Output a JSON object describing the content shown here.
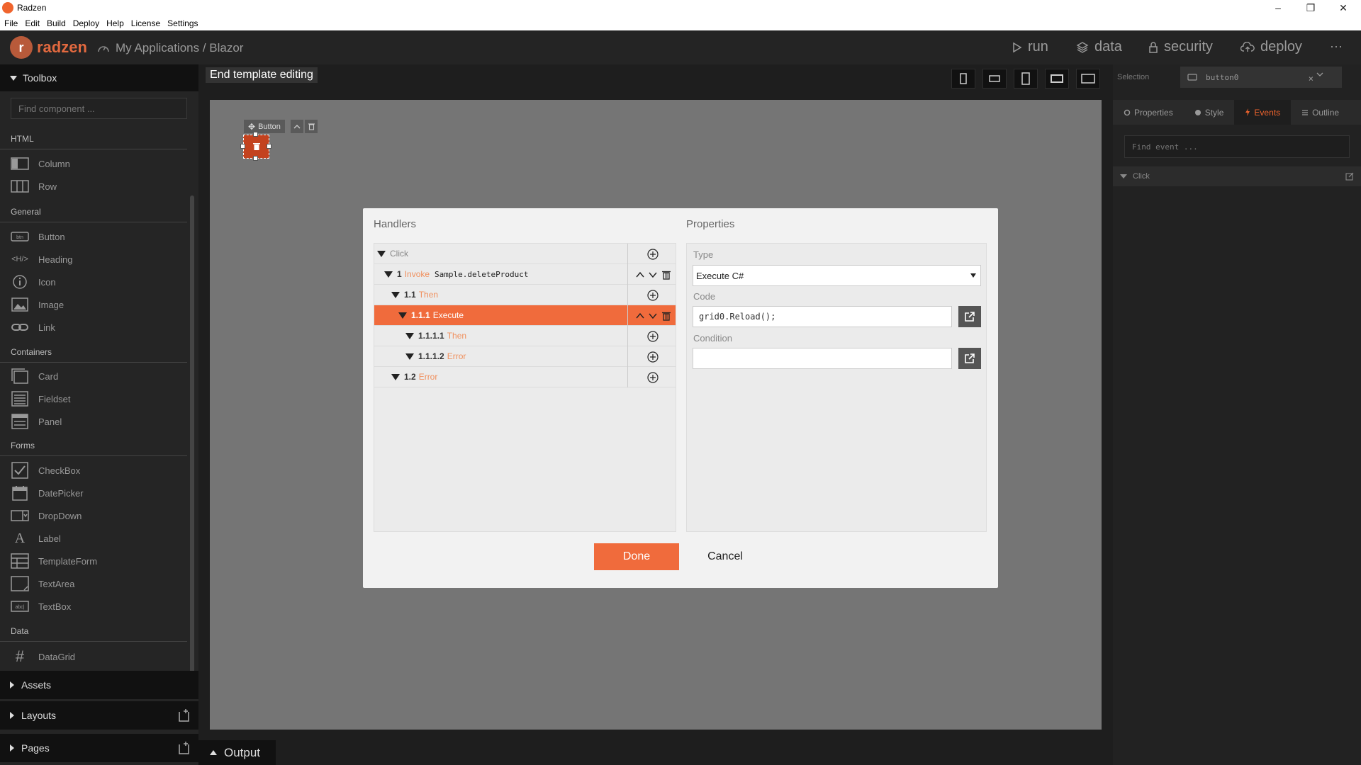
{
  "window": {
    "title": "Radzen"
  },
  "menu": [
    "File",
    "Edit",
    "Build",
    "Deploy",
    "Help",
    "License",
    "Settings"
  ],
  "header": {
    "logo_text": "radzen",
    "breadcrumb": "My Applications / Blazor",
    "nav": {
      "run": "run",
      "data": "data",
      "security": "security",
      "deploy": "deploy"
    }
  },
  "toolbox": {
    "title": "Toolbox",
    "search_placeholder": "Find component ...",
    "categories": {
      "html": "HTML",
      "general": "General",
      "containers": "Containers",
      "forms": "Forms",
      "data": "Data"
    },
    "items": {
      "column": "Column",
      "row": "Row",
      "button": "Button",
      "heading": "Heading",
      "icon": "Icon",
      "image": "Image",
      "link": "Link",
      "card": "Card",
      "fieldset": "Fieldset",
      "panel": "Panel",
      "checkbox": "CheckBox",
      "datepicker": "DatePicker",
      "dropdown": "DropDown",
      "label": "Label",
      "templateform": "TemplateForm",
      "textarea": "TextArea",
      "textbox": "TextBox",
      "datagrid": "DataGrid"
    },
    "sections": {
      "assets": "Assets",
      "layouts": "Layouts",
      "pages": "Pages"
    }
  },
  "editor": {
    "end_template": "End template editing",
    "component_label": "Button",
    "output": "Output"
  },
  "rightpanel": {
    "selection_label": "Selection",
    "selection_value": "button0",
    "tabs": {
      "properties": "Properties",
      "style": "Style",
      "events": "Events",
      "outline": "Outline"
    },
    "find_event_placeholder": "Find event ...",
    "click_event": "Click"
  },
  "modal": {
    "handlers_title": "Handlers",
    "properties_title": "Properties",
    "handlers": {
      "root": "Click",
      "r1": {
        "num": "1",
        "kind": "Invoke",
        "code": "Sample.deleteProduct"
      },
      "r2": {
        "num": "1.1",
        "kind": "Then"
      },
      "r3": {
        "num": "1.1.1",
        "kind": "Execute"
      },
      "r4": {
        "num": "1.1.1.1",
        "kind": "Then"
      },
      "r5": {
        "num": "1.1.1.2",
        "kind": "Error"
      },
      "r6": {
        "num": "1.2",
        "kind": "Error"
      }
    },
    "props": {
      "type_label": "Type",
      "type_value": "Execute C#",
      "code_label": "Code",
      "code_value": "grid0.Reload();",
      "condition_label": "Condition",
      "condition_value": ""
    },
    "done": "Done",
    "cancel": "Cancel"
  },
  "colors": {
    "accent": "#f06b3c",
    "brand": "#e2693f"
  }
}
